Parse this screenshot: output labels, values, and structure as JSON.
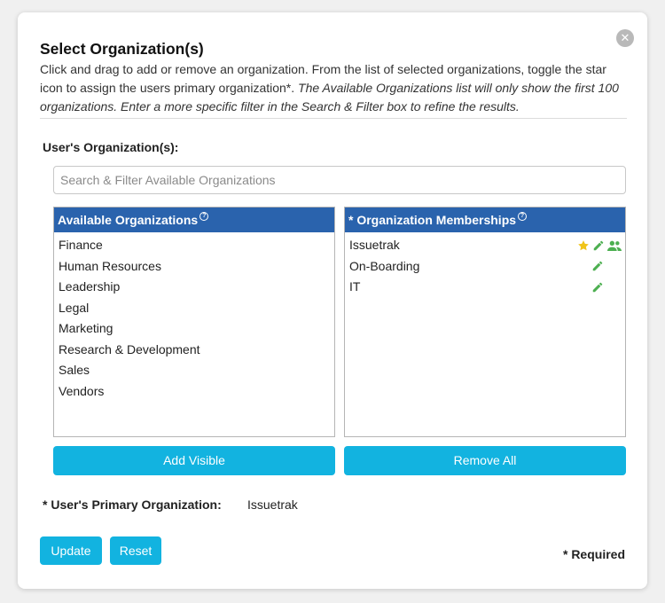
{
  "dialog": {
    "title": "Select Organization(s)",
    "description_text": "Click and drag to add or remove an organization. From the list of selected organizations, toggle the star icon to assign the users primary organization*.",
    "description_italic": "The Available Organizations list will only show the first 100 organizations. Enter a more specific filter in the Search & Filter box to refine the results.",
    "close_icon": "close-icon"
  },
  "orgs_label": "User's Organization(s):",
  "search": {
    "placeholder": "Search & Filter Available Organizations",
    "value": ""
  },
  "available": {
    "header": "Available Organizations",
    "help_glyph": "?",
    "items": [
      "Finance",
      "Human Resources",
      "Leadership",
      "Legal",
      "Marketing",
      "Research & Development",
      "Sales",
      "Vendors"
    ]
  },
  "memberships": {
    "header": "* Organization Memberships",
    "help_glyph": "?",
    "items": [
      {
        "label": "Issuetrak",
        "icons": [
          "star-icon",
          "pencil-icon",
          "users-icon"
        ]
      },
      {
        "label": "On-Boarding",
        "icons": [
          "pencil-icon"
        ]
      },
      {
        "label": "IT",
        "icons": [
          "pencil-icon"
        ]
      }
    ]
  },
  "buttons": {
    "add_visible": "Add Visible",
    "remove_all": "Remove All",
    "update": "Update",
    "reset": "Reset"
  },
  "primary": {
    "label": "* User's Primary Organization:",
    "value": "Issuetrak"
  },
  "required_note": "* Required",
  "colors": {
    "header_blue": "#2a63ad",
    "button_cyan": "#12b3e0",
    "star_yellow": "#f0c419",
    "icon_green": "#4caf50"
  }
}
